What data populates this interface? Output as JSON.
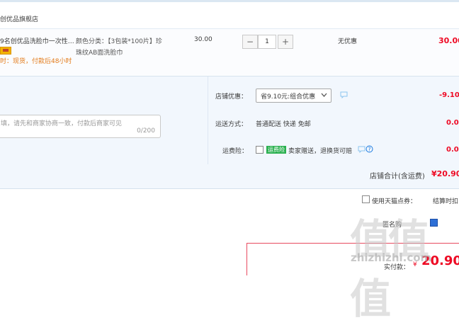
{
  "shop": {
    "name": "创优品旗舰店"
  },
  "item": {
    "title": "9名创优品洗脸巾一次性…",
    "delivery_note": "时：现货，付款后48小时",
    "spec_line1": "颜色分类：【3包装*100片】珍",
    "spec_line2": "珠纹AB面洗脸巾",
    "unit_price": "30.00",
    "quantity": "1",
    "qty_minus": "−",
    "qty_plus": "+",
    "discount": "无优惠",
    "subtotal": "30.00"
  },
  "order": {
    "shop_discount_label": "店铺优惠：",
    "shop_discount_value": "省9.10元:组合优惠",
    "shop_discount_amount": "-9.10",
    "memo_placeholder": "填，请先和商家协商一致，付款后商家可见",
    "memo_count": "0/200",
    "shipping_label": "运送方式：",
    "shipping_value": "普通配送 快递 免邮",
    "shipping_amount": "0.00",
    "insurance_label": "运费险：",
    "insurance_tag": "运费险",
    "insurance_value": "卖家赠送，退换货可赔",
    "insurance_amount": "0.00",
    "total_label": "店铺合计(含运费)",
    "total_value": "¥20.90"
  },
  "footer": {
    "points_label": "使用天猫点券：",
    "points_right": "结算时扣",
    "anon_label": "匿名购",
    "pay_label": "实付款：",
    "pay_currency": "¥",
    "pay_value": "20.90"
  },
  "watermark": {
    "glyphs": "值值值",
    "site": "zhizhizhi.com"
  },
  "colors": {
    "accent_red": "#ee0a24",
    "orange": "#e37b1a",
    "panel_blue": "#f2f7fd",
    "link_blue": "#1a7ae0",
    "green_tag": "#2ab04f"
  }
}
